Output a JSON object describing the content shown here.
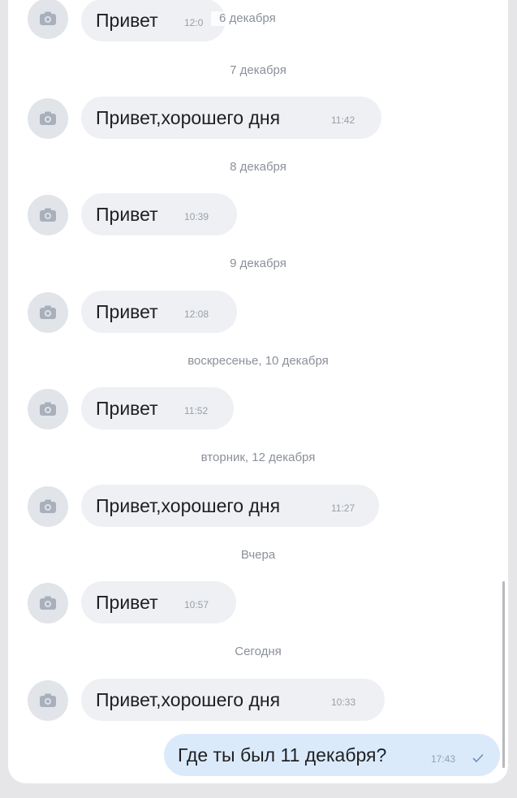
{
  "messages": [
    {
      "text": "Привет",
      "time": "12:0"
    },
    {
      "date": "7 декабря",
      "text": "Привет,хорошего дня",
      "time": "11:42"
    },
    {
      "date": "8 декабря",
      "text": "Привет",
      "time": "10:39"
    },
    {
      "date": "9 декабря",
      "text": "Привет",
      "time": "12:08"
    },
    {
      "date": "воскресенье, 10 декабря",
      "text": "Привет",
      "time": "11:52"
    },
    {
      "date": "вторник, 12 декабря",
      "text": "Привет,хорошего дня",
      "time": "11:27"
    },
    {
      "date": "Вчера",
      "text": "Привет",
      "time": "10:57"
    },
    {
      "date": "Сегодня",
      "text": "Привет,хорошего дня",
      "time": "10:33"
    }
  ],
  "sticky_date": "6 декабря",
  "outgoing": {
    "text": "Где ты был 11 декабря?",
    "time": "17:43"
  },
  "icons": {
    "avatar": "camera-icon",
    "read_status": "check-icon"
  }
}
